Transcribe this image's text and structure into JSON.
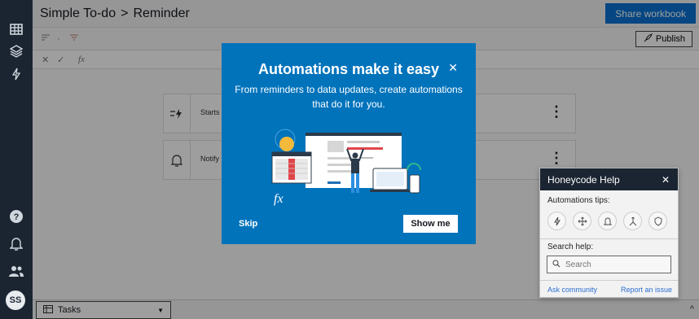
{
  "header": {
    "workbook": "Simple To-do",
    "separator": ">",
    "page": "Reminder",
    "share_label": "Share workbook"
  },
  "toolbar": {
    "publish_label": "Publish"
  },
  "formula_bar": {
    "cancel": "✕",
    "confirm": "✓",
    "fx": "fx"
  },
  "automations": [
    {
      "label": "Starts"
    },
    {
      "label": "Notify"
    }
  ],
  "bottom": {
    "tab_label": "Tasks"
  },
  "user": {
    "initials": "SS"
  },
  "modal": {
    "title": "Automations make it easy",
    "subtitle": "From reminders to data updates, create automations that do it for you.",
    "fx_label": "fx",
    "skip_label": "Skip",
    "show_me_label": "Show me"
  },
  "help": {
    "title": "Honeycode Help",
    "tips_label": "Automations tips:",
    "search_label": "Search help:",
    "search_placeholder": "Search",
    "ask_label": "Ask community",
    "report_label": "Report an issue"
  },
  "icons": [
    "table-icon",
    "layers-icon",
    "bolt-icon",
    "help-icon",
    "bell-icon",
    "users-icon"
  ],
  "colors": {
    "modal_bg": "#0073bb",
    "rail_bg": "#1b2532",
    "primary_button": "#0972d3",
    "link": "#2b6fd3"
  }
}
